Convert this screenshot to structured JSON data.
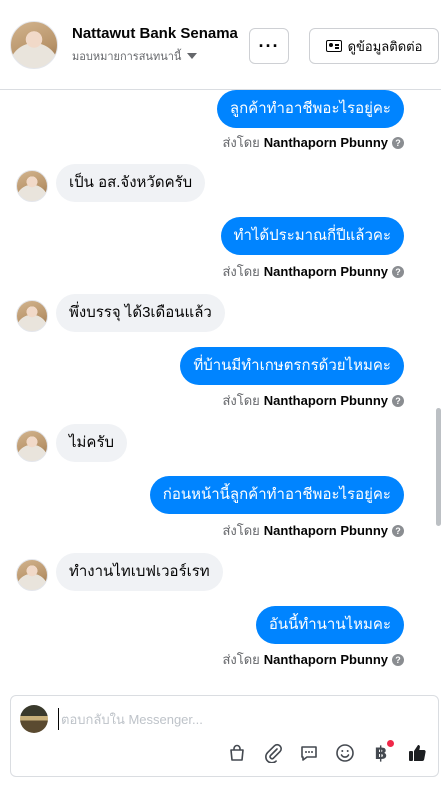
{
  "header": {
    "name": "Nattawut Bank Senama",
    "subtitle": "มอบหมายการสนทนานี้",
    "more_label": "···",
    "contact_label": "ดูข้อมูลติดต่อ"
  },
  "messages": [
    {
      "side": "out",
      "text": "ลูกค้าทำอาชีพอะไรอยู่คะ",
      "sent_by_prefix": "ส่งโดย",
      "sent_by_name": "Nanthaporn Pbunny"
    },
    {
      "side": "in",
      "text": "เป็น อส.จังหวัดครับ"
    },
    {
      "side": "out",
      "text": "ทำได้ประมาณกี่ปีแล้วคะ",
      "sent_by_prefix": "ส่งโดย",
      "sent_by_name": "Nanthaporn Pbunny"
    },
    {
      "side": "in",
      "text": "พึ่งบรรจุ ได้3เดือนแล้ว"
    },
    {
      "side": "out",
      "text": "ที่บ้านมีทำเกษตรกรด้วยไหมคะ",
      "sent_by_prefix": "ส่งโดย",
      "sent_by_name": "Nanthaporn Pbunny"
    },
    {
      "side": "in",
      "text": "ไม่ครับ"
    },
    {
      "side": "out",
      "text": "ก่อนหน้านี้ลูกค้าทำอาชีพอะไรอยู่คะ",
      "sent_by_prefix": "ส่งโดย",
      "sent_by_name": "Nanthaporn Pbunny"
    },
    {
      "side": "in",
      "text": "ทำงานไทเบฟเวอร์เรท"
    },
    {
      "side": "out",
      "text": "อันนี้ทำนานไหมคะ",
      "sent_by_prefix": "ส่งโดย",
      "sent_by_name": "Nanthaporn Pbunny"
    }
  ],
  "composer": {
    "placeholder": "ตอบกลับใน Messenger...",
    "tools": [
      "shopping-bag-icon",
      "paperclip-icon",
      "saved-reply-icon",
      "emoji-icon",
      "baht-icon",
      "thumbs-up-icon"
    ]
  },
  "colors": {
    "accent": "#0084ff",
    "incoming_bubble": "#f0f2f5",
    "secondary_text": "#65676b"
  }
}
